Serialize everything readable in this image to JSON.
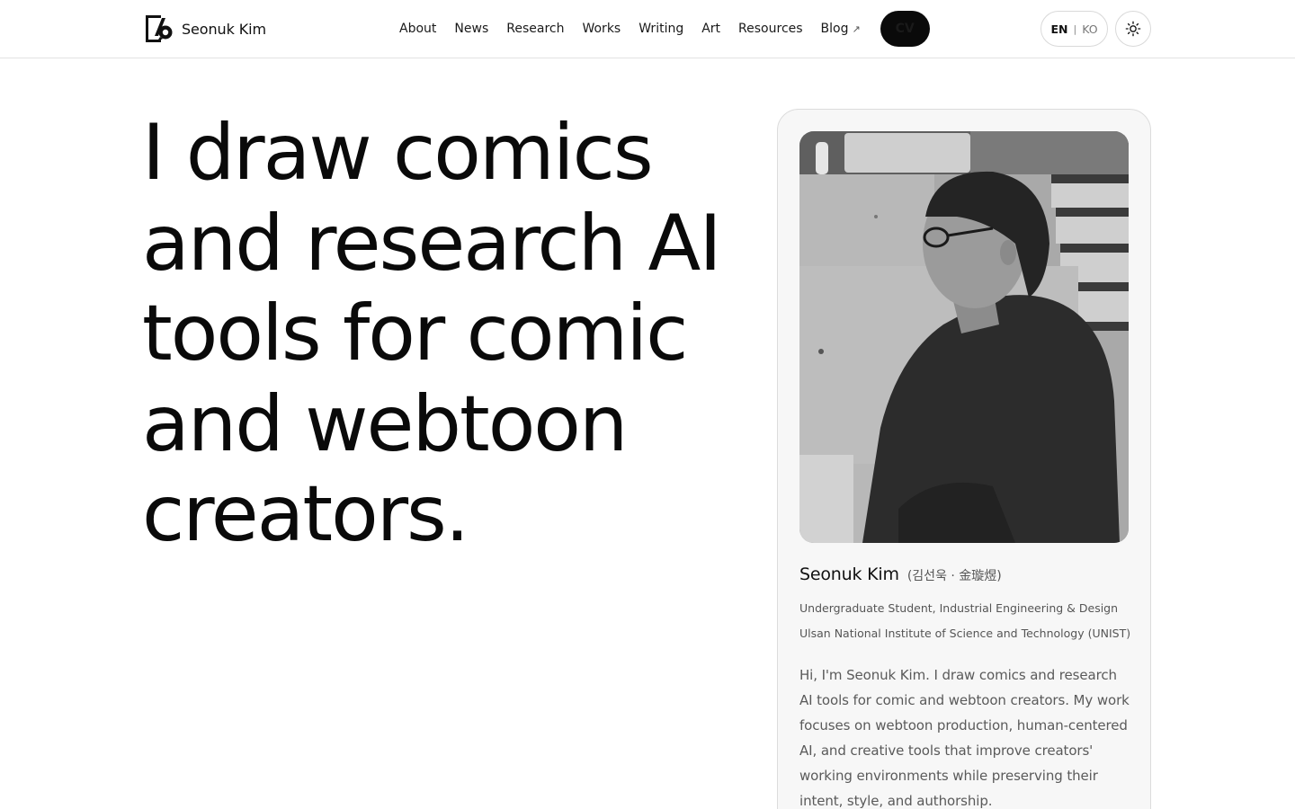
{
  "header": {
    "brand_name": "Seonuk Kim",
    "nav": {
      "about": "About",
      "news": "News",
      "research": "Research",
      "works": "Works",
      "writing": "Writing",
      "art": "Art",
      "resources": "Resources",
      "blog": "Blog"
    },
    "blog_external_icon": "arrow-up-right-icon",
    "cv_label": "CV",
    "lang": {
      "en": "EN",
      "separator": "|",
      "ko": "KO",
      "active": "EN"
    },
    "theme_icon": "sun-icon"
  },
  "hero": {
    "title": "I draw comics and research AI tools for comic and webtoon creators."
  },
  "profile": {
    "photo_alt": "Grayscale photo of Seonuk Kim",
    "name": "Seonuk Kim",
    "name_native": "(김선욱 · 金璇煜)",
    "affiliation_line1": "Undergraduate Student, Industrial Engineering & Design",
    "affiliation_line2": "Ulsan National Institute of Science and Technology (UNIST)",
    "bio": "Hi, I'm Seonuk Kim. I draw comics and research AI tools for comic and webtoon creators. My work focuses on webtoon production, human-centered AI, and creative tools that improve creators' working environments while preserving their intent, style, and authorship."
  },
  "colors": {
    "text": "#0a0a0a",
    "muted": "#5a5a5a",
    "border": "#dcdcdc",
    "card_bg": "#f7f7f7",
    "button_bg": "#0a0a0a"
  }
}
